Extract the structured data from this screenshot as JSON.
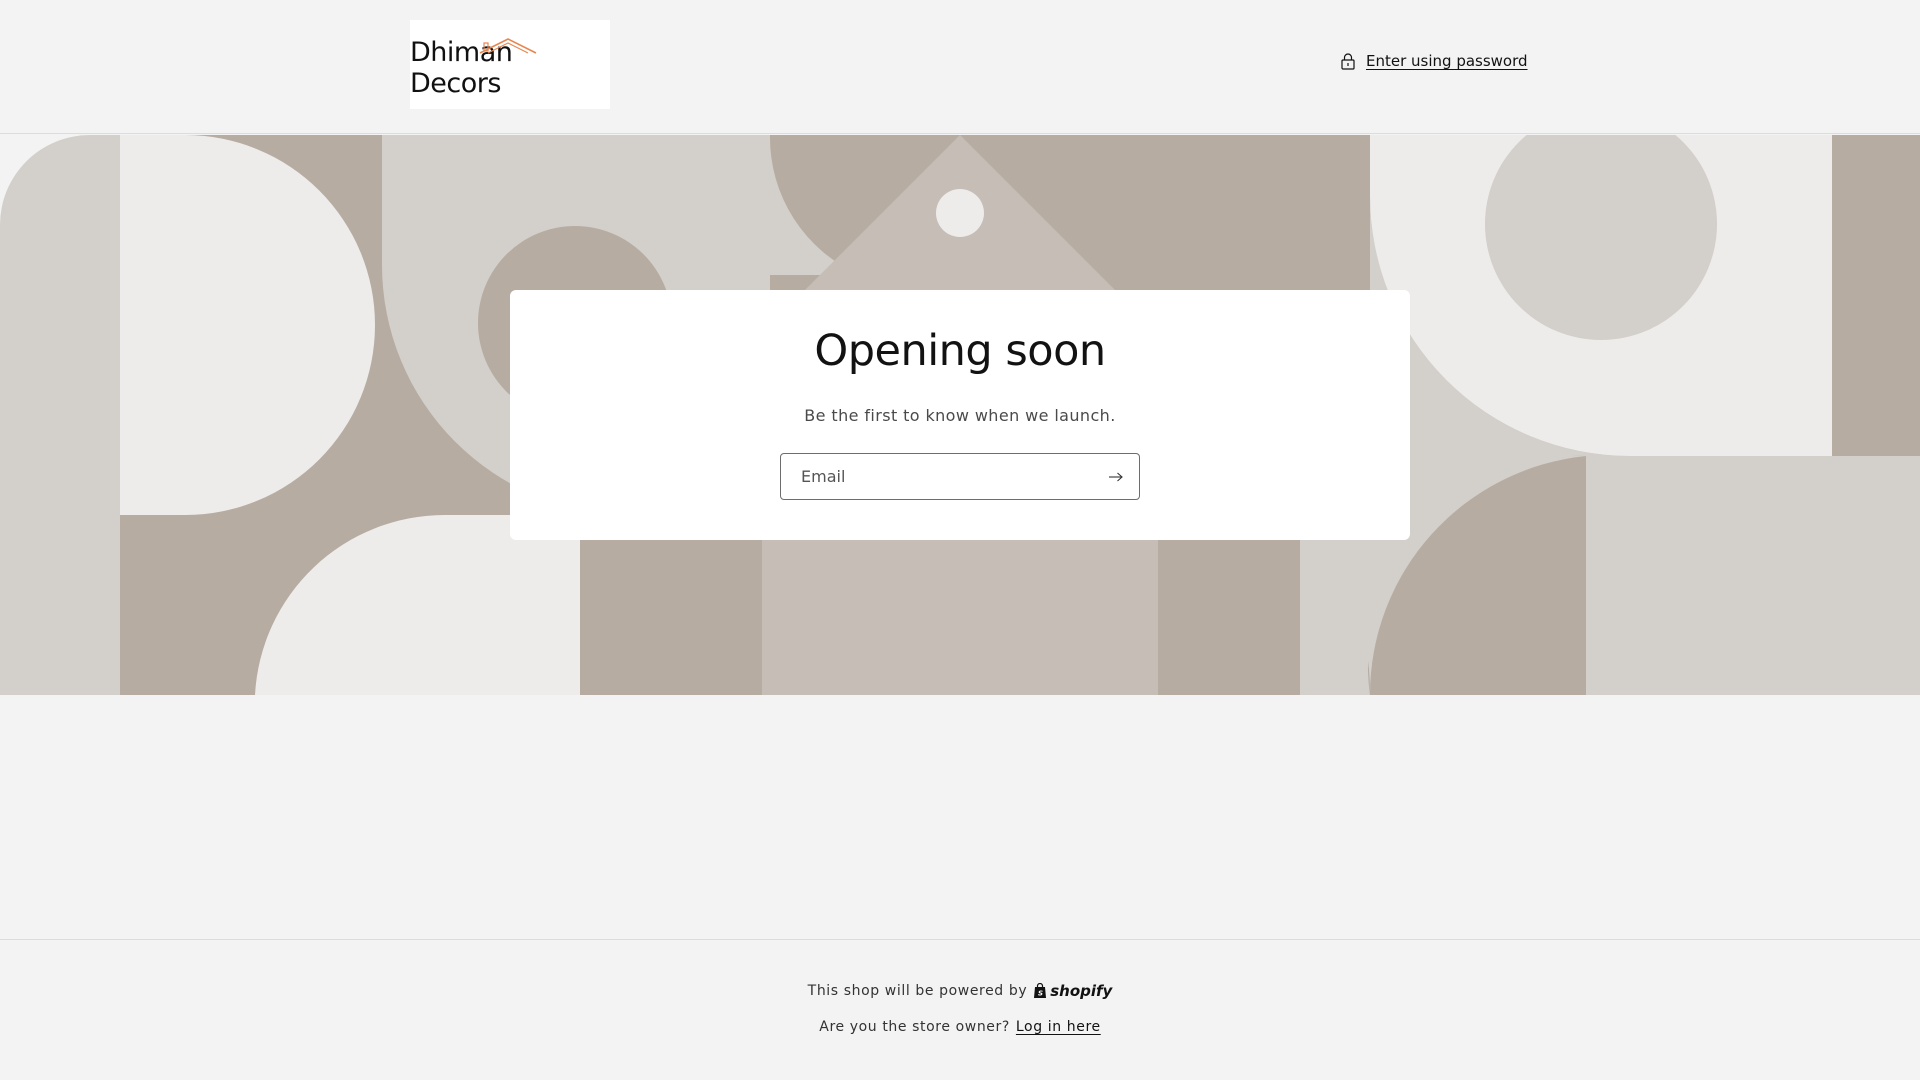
{
  "header": {
    "logo_text": "Dhiman Decors",
    "password_link": "Enter using password"
  },
  "main": {
    "title": "Opening soon",
    "subtitle": "Be the first to know when we launch.",
    "email_placeholder": "Email"
  },
  "footer": {
    "powered_by": "This shop will be powered by",
    "shopify_brand": "shopify",
    "owner_question": "Are you the store owner?",
    "login_link": "Log in here"
  },
  "icons": {
    "lock": "lock-icon",
    "submit": "arrow-right-icon",
    "shopify": "shopify-bag-icon"
  },
  "colors": {
    "background": "#f3f3f3",
    "banner_dark": "#b6aca2",
    "banner_mid": "#c6bdb7",
    "banner_light": "#d3cfca",
    "banner_lightest": "#edecea",
    "logo_roof": "#e8864f"
  }
}
